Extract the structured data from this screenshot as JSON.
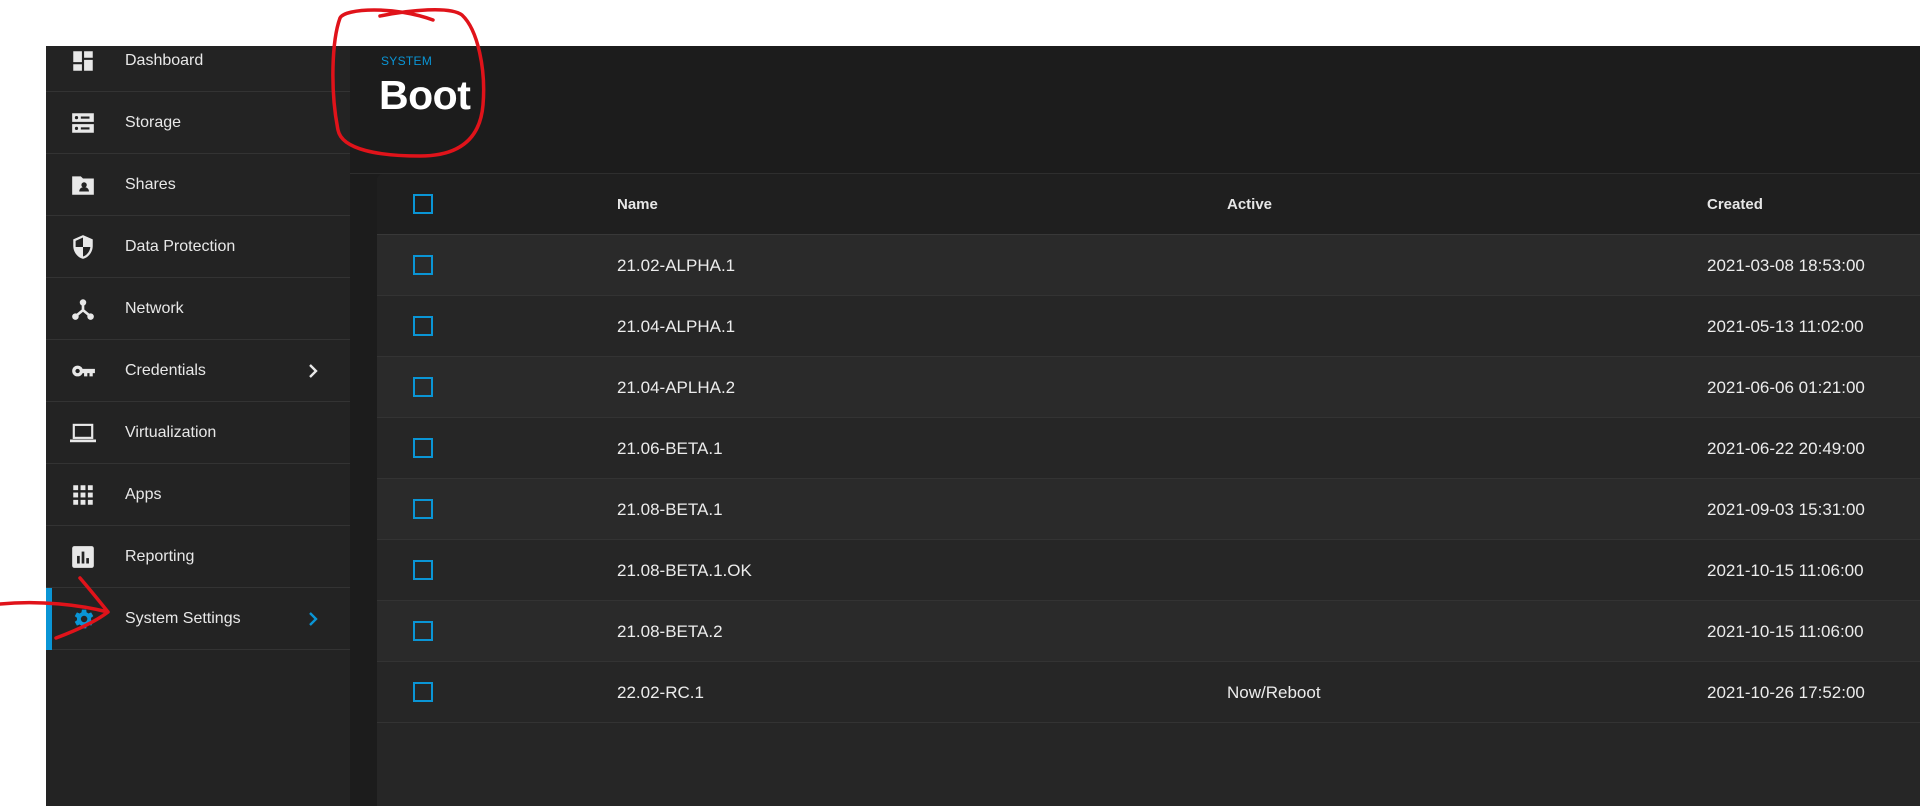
{
  "sidebar": {
    "items": [
      {
        "label": "Dashboard",
        "icon": "dashboard-icon"
      },
      {
        "label": "Storage",
        "icon": "storage-icon"
      },
      {
        "label": "Shares",
        "icon": "shares-icon"
      },
      {
        "label": "Data Protection",
        "icon": "shield-icon"
      },
      {
        "label": "Network",
        "icon": "network-icon"
      },
      {
        "label": "Credentials",
        "icon": "key-icon",
        "has_submenu": true
      },
      {
        "label": "Virtualization",
        "icon": "laptop-icon"
      },
      {
        "label": "Apps",
        "icon": "apps-grid-icon"
      },
      {
        "label": "Reporting",
        "icon": "reporting-icon"
      },
      {
        "label": "System Settings",
        "icon": "gear-icon",
        "has_submenu": true,
        "active": true
      }
    ]
  },
  "header": {
    "breadcrumb": "SYSTEM",
    "title": "Boot"
  },
  "table": {
    "columns": {
      "name": "Name",
      "active": "Active",
      "created": "Created"
    },
    "rows": [
      {
        "name": "21.02-ALPHA.1",
        "active": "",
        "created": "2021-03-08 18:53:00"
      },
      {
        "name": "21.04-ALPHA.1",
        "active": "",
        "created": "2021-05-13 11:02:00"
      },
      {
        "name": "21.04-APLHA.2",
        "active": "",
        "created": "2021-06-06 01:21:00"
      },
      {
        "name": "21.06-BETA.1",
        "active": "",
        "created": "2021-06-22 20:49:00"
      },
      {
        "name": "21.08-BETA.1",
        "active": "",
        "created": "2021-09-03 15:31:00"
      },
      {
        "name": "21.08-BETA.1.OK",
        "active": "",
        "created": "2021-10-15 11:06:00"
      },
      {
        "name": "21.08-BETA.2",
        "active": "",
        "created": "2021-10-15 11:06:00"
      },
      {
        "name": "22.02-RC.1",
        "active": "Now/Reboot",
        "created": "2021-10-26 17:52:00"
      }
    ]
  },
  "colors": {
    "accent": "#0a95d5",
    "annotation": "#e0131a",
    "sidebar_bg": "#232323",
    "main_bg": "#1c1c1c"
  }
}
